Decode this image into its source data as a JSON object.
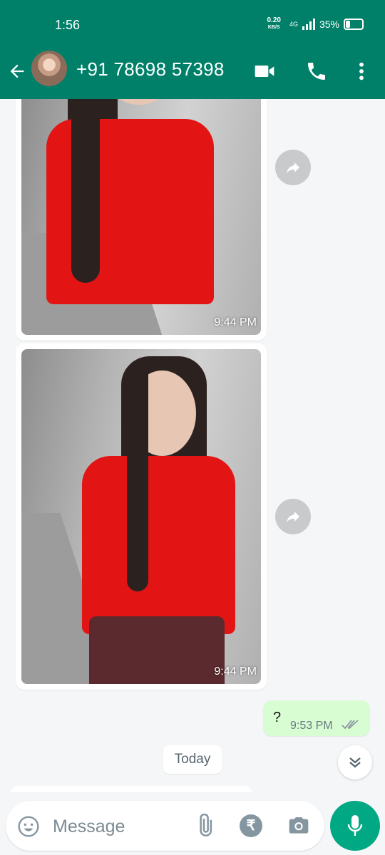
{
  "status_bar": {
    "time": "1:56",
    "net_speed_value": "0.20",
    "net_speed_unit": "KB/S",
    "network": "4G",
    "battery": "35%",
    "battery_level": 0.35
  },
  "header": {
    "contact_name": "+91 78698 57398",
    "icons": [
      "back-arrow-icon",
      "avatar",
      "video-call-icon",
      "phone-icon",
      "more-vert-icon"
    ]
  },
  "messages": [
    {
      "type": "image",
      "direction": "incoming",
      "time": "9:44 PM"
    },
    {
      "type": "image",
      "direction": "incoming",
      "time": "9:44 PM"
    },
    {
      "type": "text",
      "direction": "outgoing",
      "text": "?",
      "time": "9:53 PM",
      "status": "read"
    }
  ],
  "date_divider": "Today",
  "composer": {
    "placeholder": "Message",
    "rupee_symbol": "₹"
  },
  "colors": {
    "header": "#008069",
    "outgoing_bubble": "#d9fdd3",
    "mic_button": "#00a884",
    "chat_background": "#f4f6f7"
  }
}
